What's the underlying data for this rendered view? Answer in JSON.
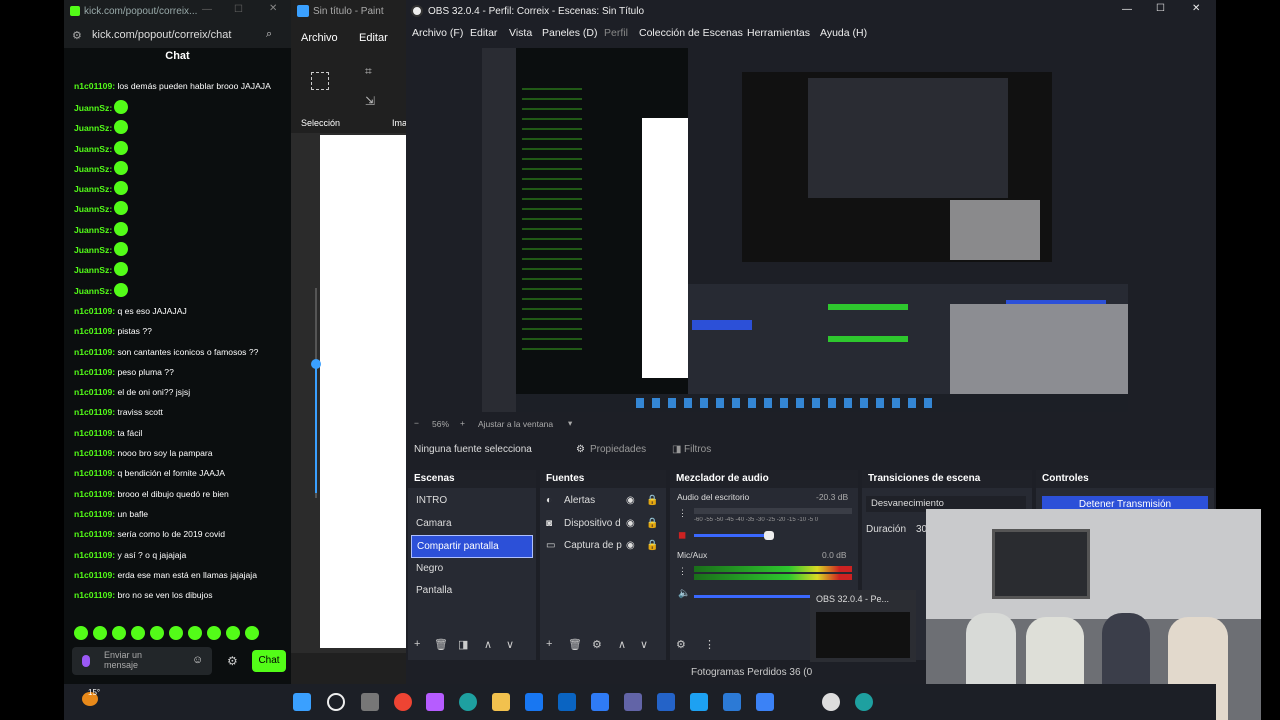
{
  "kick": {
    "title_url": "kick.com/popout/correix...",
    "url": "kick.com/popout/correix/chat",
    "header": "Chat",
    "messages": [
      {
        "user": "n1c01109:",
        "text": "los demás pueden hablar brooo JAJAJA",
        "emote": false,
        "two_line": true
      },
      {
        "user": "JuannSz:",
        "text": "",
        "emote": true
      },
      {
        "user": "JuannSz:",
        "text": "",
        "emote": true
      },
      {
        "user": "JuannSz:",
        "text": "",
        "emote": true
      },
      {
        "user": "JuannSz:",
        "text": "",
        "emote": true
      },
      {
        "user": "JuannSz:",
        "text": "",
        "emote": true
      },
      {
        "user": "JuannSz:",
        "text": "",
        "emote": true
      },
      {
        "user": "JuannSz:",
        "text": "",
        "emote": true
      },
      {
        "user": "JuannSz:",
        "text": "",
        "emote": true
      },
      {
        "user": "JuannSz:",
        "text": "",
        "emote": true
      },
      {
        "user": "JuannSz:",
        "text": "",
        "emote": true
      },
      {
        "user": "n1c01109:",
        "text": "q es eso JAJAJAJ"
      },
      {
        "user": "n1c01109:",
        "text": "pistas ??"
      },
      {
        "user": "n1c01109:",
        "text": "son cantantes iconicos o famosos ??"
      },
      {
        "user": "n1c01109:",
        "text": "peso pluma ??"
      },
      {
        "user": "n1c01109:",
        "text": "el de oni oni?? jsjsj"
      },
      {
        "user": "n1c01109:",
        "text": "traviss scott"
      },
      {
        "user": "n1c01109:",
        "text": "ta fácil"
      },
      {
        "user": "n1c01109:",
        "text": "nooo bro soy la pampara"
      },
      {
        "user": "n1c01109:",
        "text": "q bendición el fornite JAAJA"
      },
      {
        "user": "n1c01109:",
        "text": "brooo el dibujo quedó re bien"
      },
      {
        "user": "n1c01109:",
        "text": "un bafle"
      },
      {
        "user": "n1c01109:",
        "text": "sería como lo de 2019 covid"
      },
      {
        "user": "n1c01109:",
        "text": "y así ? o q jajajaja"
      },
      {
        "user": "n1c01109:",
        "text": "erda ese man está en llamas jajajaja"
      },
      {
        "user": "n1c01109:",
        "text": "bro no se ven los dibujos"
      }
    ],
    "input_placeholder": "Enviar un mensaje",
    "send_label": "Chat"
  },
  "paint": {
    "title": "Sin título - Paint",
    "menu_file": "Archivo",
    "menu_edit": "Editar",
    "selection_label": "Selección",
    "image_label": "Ima"
  },
  "obs": {
    "title": "OBS 32.0.4 - Perfil: Correix - Escenas: Sin Título",
    "menu": [
      "Archivo (F)",
      "Editar",
      "Vista",
      "Paneles (D)",
      "Perfil",
      "Colección de Escenas",
      "Herramientas",
      "Ayuda (H)"
    ],
    "zoom": "56%",
    "fit_label": "Ajustar a la ventana",
    "no_source": "Ninguna fuente selecciona",
    "properties": "Propiedades",
    "filters": "Filtros",
    "scenes_title": "Escenas",
    "scenes": [
      "INTRO",
      "Camara",
      "Compartir pantalla",
      "Negro",
      "Pantalla"
    ],
    "selected_scene": 2,
    "sources_title": "Fuentes",
    "sources": [
      "Alertas",
      "Dispositivo d",
      "Captura de p"
    ],
    "mixer_title": "Mezclador de audio",
    "mixer": [
      {
        "name": "Audio del escritorio",
        "db": "-20.3 dB",
        "level": 0.0
      },
      {
        "name": "Mic/Aux",
        "db": "0.0 dB",
        "level": 1.0
      }
    ],
    "meter_ticks": "-60 -55 -50 -45 -40 -35 -30 -25 -20 -15 -10 -5 0",
    "transitions_title": "Transiciones de escena",
    "transition": "Desvanecimiento",
    "duration_label": "Duración",
    "duration_value": "30",
    "controls_title": "Controles",
    "stop_stream": "Detener Transmisión",
    "frames_dropped": "Fotogramas Perdidos 36 (0",
    "taskbar_popup": "OBS 32.0.4 - Pe..."
  },
  "taskbar": {
    "weather": "15°"
  },
  "colors": {
    "kick_green": "#53fc18",
    "obs_select": "#2c50d8",
    "obs_bg": "#1d1f26"
  }
}
